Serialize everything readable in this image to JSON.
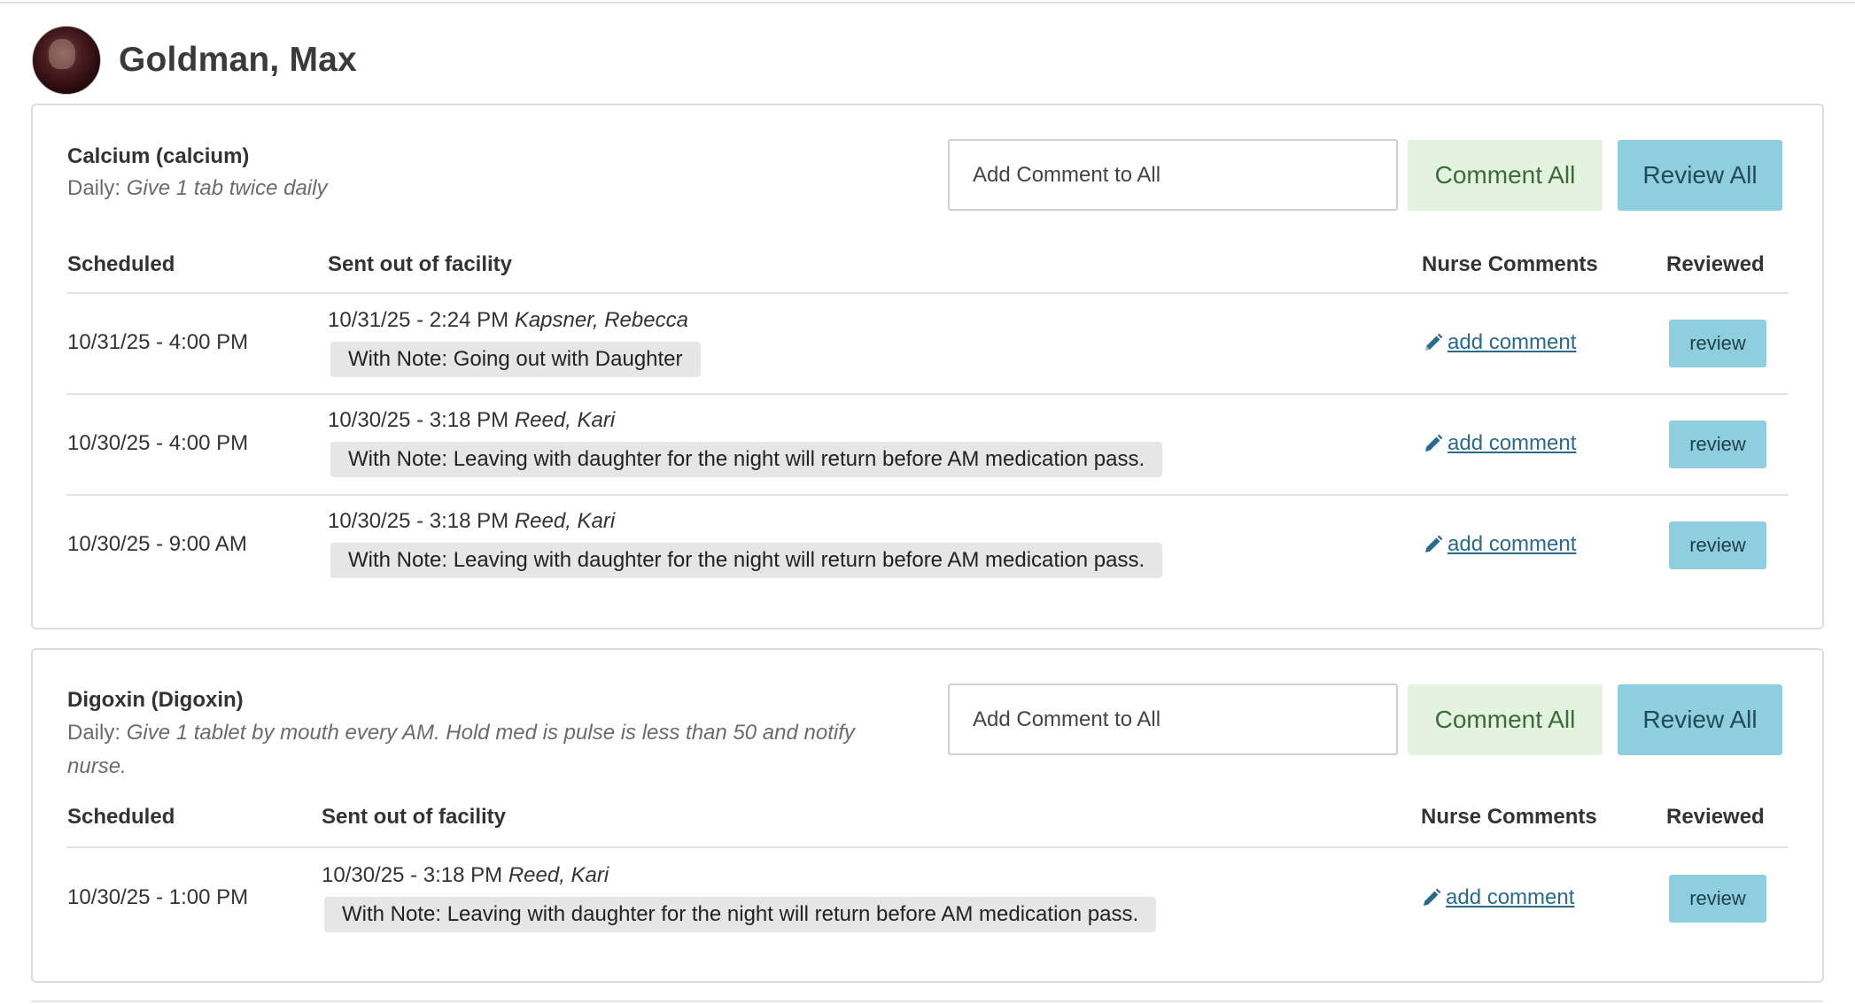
{
  "patient": {
    "name": "Goldman, Max"
  },
  "icons": {
    "avatar": "patient-photo",
    "edit": "pencil-icon"
  },
  "colors": {
    "comment_all_bg": "#e3f3df",
    "comment_all_text": "#3d6a37",
    "review_bg": "#8dcfdf",
    "link": "#2a6a8a",
    "note_bg": "#e6e6e6"
  },
  "medications": [
    {
      "name": "Calcium (calcium)",
      "frequency": "Daily:",
      "instructions": "Give 1 tab twice daily",
      "comment_all_placeholder": "Add Comment to All",
      "comment_all_label": "Comment All",
      "review_all_label": "Review All",
      "headers": {
        "scheduled": "Scheduled",
        "sent": "Sent out of facility",
        "comments": "Nurse Comments",
        "reviewed": "Reviewed"
      },
      "rows": [
        {
          "scheduled": "10/31/25 - 4:00 PM",
          "sent_time": "10/31/25 - 2:24 PM",
          "sent_by": "Kapsner, Rebecca",
          "note": "With Note: Going out with Daughter",
          "comment_link": "add comment",
          "review_label": "review"
        },
        {
          "scheduled": "10/30/25 - 4:00 PM",
          "sent_time": "10/30/25 - 3:18 PM",
          "sent_by": "Reed, Kari",
          "note": "With Note: Leaving with daughter for the night will return before AM medication pass.",
          "comment_link": "add comment",
          "review_label": "review"
        },
        {
          "scheduled": "10/30/25 - 9:00 AM",
          "sent_time": "10/30/25 - 3:18 PM",
          "sent_by": "Reed, Kari",
          "note": "With Note: Leaving with daughter for the night will return before AM medication pass.",
          "comment_link": "add comment",
          "review_label": "review"
        }
      ]
    },
    {
      "name": "Digoxin (Digoxin)",
      "frequency": "Daily:",
      "instructions": "Give 1 tablet by mouth every AM. Hold med is pulse is less than 50 and notify",
      "instructions_cont": "nurse.",
      "comment_all_placeholder": "Add Comment to All",
      "comment_all_label": "Comment All",
      "review_all_label": "Review All",
      "headers": {
        "scheduled": "Scheduled",
        "sent": "Sent out of facility",
        "comments": "Nurse Comments",
        "reviewed": "Reviewed"
      },
      "rows": [
        {
          "scheduled": "10/30/25 - 1:00 PM",
          "sent_time": "10/30/25 - 3:18 PM",
          "sent_by": "Reed, Kari",
          "note": "With Note: Leaving with daughter for the night will return before AM medication pass.",
          "comment_link": "add comment",
          "review_label": "review"
        }
      ]
    }
  ]
}
